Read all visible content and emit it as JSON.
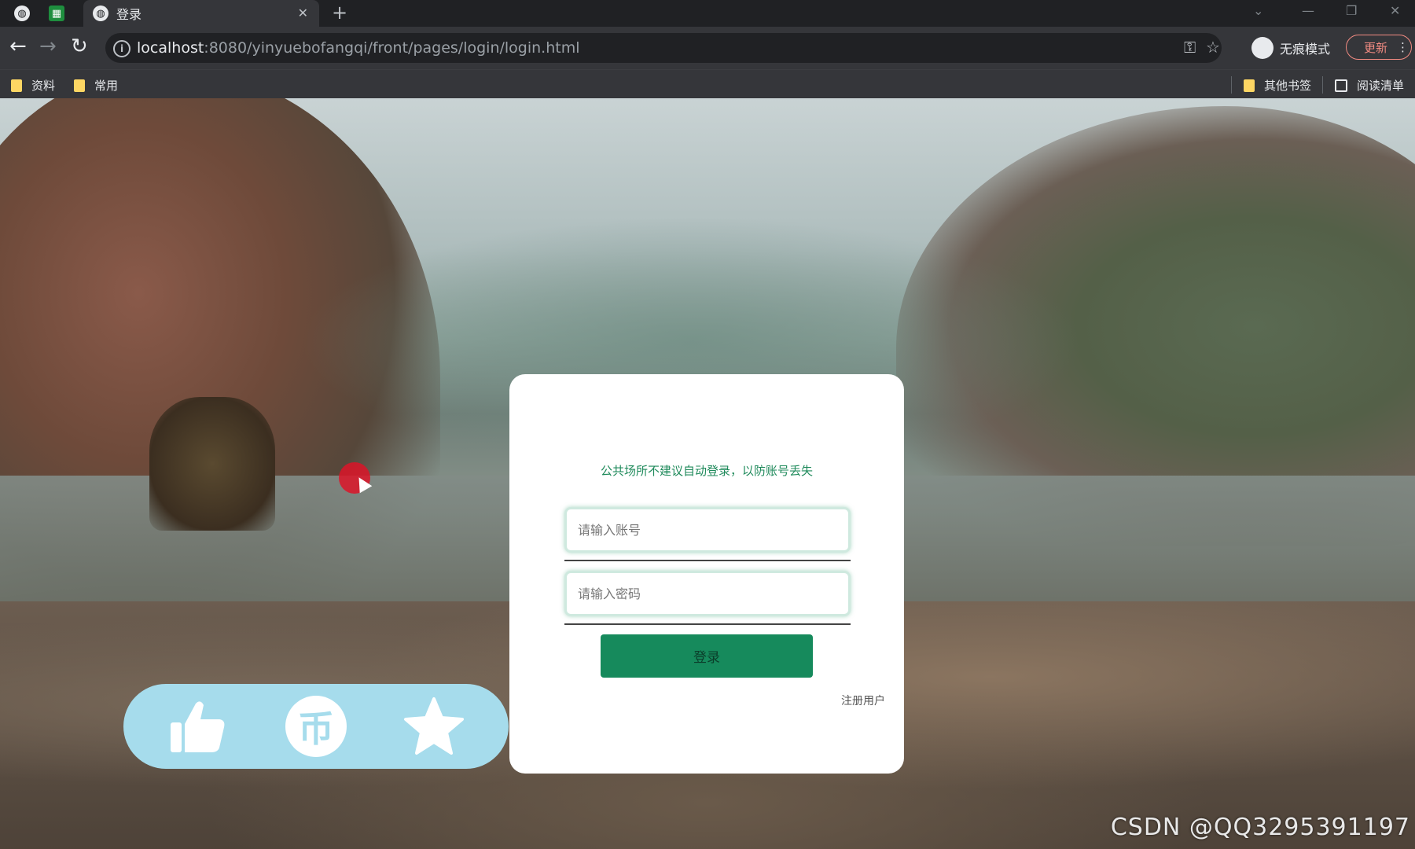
{
  "browser": {
    "tabs": [
      {
        "title": ""
      },
      {
        "title": ""
      },
      {
        "title": "登录"
      }
    ],
    "new_tab_label": "+",
    "url": {
      "host": "localhost",
      "path": ":8080/yinyuebofangqi/front/pages/login/login.html"
    },
    "incognito_label": "无痕模式",
    "update_label": "更新",
    "bookmarks": [
      {
        "label": "资料"
      },
      {
        "label": "常用"
      }
    ],
    "bookmarks_right": [
      {
        "label": "其他书签"
      },
      {
        "label": "阅读清单"
      }
    ]
  },
  "login": {
    "notice": "公共场所不建议自动登录，以防账号丢失",
    "account_placeholder": "请输入账号",
    "password_placeholder": "请输入密码",
    "login_button": "登录",
    "register_link": "注册用户"
  },
  "actions": {
    "coin_glyph": "币"
  },
  "watermark": "CSDN @QQ3295391197",
  "colors": {
    "accent": "#168a5c",
    "notice": "#1f8a5b",
    "action_bg": "#a6dcec"
  }
}
